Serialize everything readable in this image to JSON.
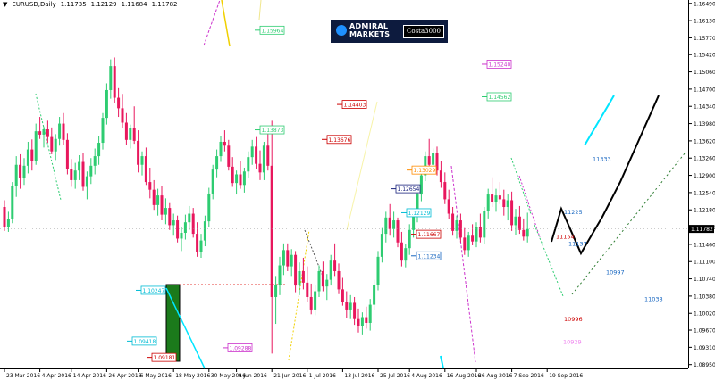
{
  "header": {
    "menu_arrow": "dropdown-triangle",
    "symbol": "EURUSD,Daily",
    "ohlc": [
      "1.11735",
      "1.12129",
      "1.11684",
      "1.11782"
    ]
  },
  "logo": {
    "brand_line1": "ADMIRAL",
    "brand_line2": "MARKETS",
    "username": "Costa3000"
  },
  "colors": {
    "bull": "#2ecc71",
    "bear": "#e8175d",
    "price_tag_bg": "#000000"
  },
  "chart_data": {
    "type": "candlestick",
    "symbol": "EURUSD",
    "timeframe": "Daily",
    "last_price": "1.11782",
    "y_ticks": [
      "1.16490",
      "1.16130",
      "1.15770",
      "1.15420",
      "1.15060",
      "1.14700",
      "1.14340",
      "1.13980",
      "1.13620",
      "1.13260",
      "1.12900",
      "1.12540",
      "1.12180",
      "1.11820",
      "1.11460",
      "1.11100",
      "1.10740",
      "1.10380",
      "1.10020",
      "1.09670",
      "1.09310",
      "1.08950"
    ],
    "ylim": [
      1.0887,
      1.1656
    ],
    "x_ticks": [
      "23 Mar 2016",
      "4 Apr 2016",
      "14 Apr 2016",
      "26 Apr 2016",
      "6 May 2016",
      "18 May 2016",
      "30 May 2016",
      "9 Jun 2016",
      "21 Jun 2016",
      "1 Jul 2016",
      "13 Jul 2016",
      "25 Jul 2016",
      "4 Aug 2016",
      "16 Aug 2016",
      "26 Aug 2016",
      "7 Sep 2016",
      "19 Sep 2016"
    ],
    "x_tick_index": [
      0,
      9,
      17,
      26,
      34,
      43,
      52,
      59,
      68,
      77,
      86,
      95,
      103,
      112,
      120,
      129,
      138
    ],
    "candles": [
      [
        1.1224,
        1.1238,
        1.1174,
        1.1182
      ],
      [
        1.1182,
        1.1214,
        1.1172,
        1.1198
      ],
      [
        1.1198,
        1.1276,
        1.119,
        1.1268
      ],
      [
        1.1268,
        1.133,
        1.1245,
        1.1312
      ],
      [
        1.1312,
        1.1334,
        1.1262,
        1.1284
      ],
      [
        1.1284,
        1.1326,
        1.127,
        1.131
      ],
      [
        1.131,
        1.136,
        1.1294,
        1.1344
      ],
      [
        1.1344,
        1.1365,
        1.13,
        1.132
      ],
      [
        1.132,
        1.1398,
        1.1312,
        1.1382
      ],
      [
        1.1382,
        1.1412,
        1.1366,
        1.1375
      ],
      [
        1.1375,
        1.1392,
        1.1348,
        1.1386
      ],
      [
        1.1386,
        1.1404,
        1.1358,
        1.137
      ],
      [
        1.137,
        1.139,
        1.1334,
        1.134
      ],
      [
        1.134,
        1.1376,
        1.1322,
        1.1366
      ],
      [
        1.1366,
        1.1412,
        1.1352,
        1.1398
      ],
      [
        1.1398,
        1.142,
        1.1354,
        1.1364
      ],
      [
        1.1364,
        1.1378,
        1.1292,
        1.1304
      ],
      [
        1.1304,
        1.1324,
        1.1266,
        1.128
      ],
      [
        1.128,
        1.1316,
        1.1262,
        1.13
      ],
      [
        1.13,
        1.1332,
        1.128,
        1.1318
      ],
      [
        1.1318,
        1.1336,
        1.1258,
        1.1266
      ],
      [
        1.1266,
        1.1298,
        1.124,
        1.1288
      ],
      [
        1.1288,
        1.1326,
        1.1272,
        1.131
      ],
      [
        1.131,
        1.1346,
        1.1292,
        1.133
      ],
      [
        1.133,
        1.1372,
        1.1312,
        1.1358
      ],
      [
        1.1358,
        1.142,
        1.1344,
        1.141
      ],
      [
        1.141,
        1.1482,
        1.1396,
        1.1468
      ],
      [
        1.1468,
        1.1532,
        1.145,
        1.1518
      ],
      [
        1.1518,
        1.1536,
        1.144,
        1.1452
      ],
      [
        1.1452,
        1.1472,
        1.1412,
        1.143
      ],
      [
        1.143,
        1.146,
        1.1388,
        1.14
      ],
      [
        1.14,
        1.142,
        1.1354,
        1.1364
      ],
      [
        1.1364,
        1.1396,
        1.1346,
        1.1388
      ],
      [
        1.1388,
        1.1434,
        1.1356,
        1.1362
      ],
      [
        1.1362,
        1.1384,
        1.1296,
        1.1312
      ],
      [
        1.1312,
        1.134,
        1.129,
        1.133
      ],
      [
        1.133,
        1.1348,
        1.127,
        1.1276
      ],
      [
        1.1276,
        1.1306,
        1.1242,
        1.126
      ],
      [
        1.126,
        1.128,
        1.1218,
        1.1228
      ],
      [
        1.1228,
        1.1262,
        1.1206,
        1.1248
      ],
      [
        1.1248,
        1.1268,
        1.1196,
        1.1208
      ],
      [
        1.1208,
        1.1242,
        1.1188,
        1.1222
      ],
      [
        1.1222,
        1.1232,
        1.1176,
        1.1186
      ],
      [
        1.1186,
        1.121,
        1.1164,
        1.1196
      ],
      [
        1.1196,
        1.1206,
        1.115,
        1.1158
      ],
      [
        1.1158,
        1.1182,
        1.1132,
        1.117
      ],
      [
        1.117,
        1.1208,
        1.1156,
        1.1192
      ],
      [
        1.1192,
        1.1226,
        1.1176,
        1.121
      ],
      [
        1.121,
        1.1222,
        1.116,
        1.1168
      ],
      [
        1.1168,
        1.1192,
        1.112,
        1.113
      ],
      [
        1.113,
        1.1168,
        1.1118,
        1.1154
      ],
      [
        1.1154,
        1.1206,
        1.1142,
        1.1194
      ],
      [
        1.1194,
        1.1264,
        1.1182,
        1.1252
      ],
      [
        1.1252,
        1.1312,
        1.124,
        1.1302
      ],
      [
        1.1302,
        1.1344,
        1.1286,
        1.133
      ],
      [
        1.133,
        1.1372,
        1.1318,
        1.136
      ],
      [
        1.136,
        1.1384,
        1.134,
        1.1352
      ],
      [
        1.1352,
        1.1364,
        1.13,
        1.1308
      ],
      [
        1.1308,
        1.1328,
        1.1266,
        1.1274
      ],
      [
        1.1274,
        1.13,
        1.125,
        1.1292
      ],
      [
        1.1292,
        1.132,
        1.1262,
        1.127
      ],
      [
        1.127,
        1.1306,
        1.1254,
        1.1298
      ],
      [
        1.1298,
        1.134,
        1.1284,
        1.1328
      ],
      [
        1.1328,
        1.1364,
        1.1312,
        1.135
      ],
      [
        1.135,
        1.137,
        1.1304,
        1.1314
      ],
      [
        1.1314,
        1.1342,
        1.128,
        1.1296
      ],
      [
        1.1296,
        1.136,
        1.128,
        1.1352
      ],
      [
        1.1352,
        1.1376,
        1.13,
        1.131
      ],
      [
        1.131,
        1.1404,
        1.0918,
        1.1036
      ],
      [
        1.1036,
        1.108,
        1.098,
        1.1062
      ],
      [
        1.1062,
        1.112,
        1.104,
        1.1102
      ],
      [
        1.1102,
        1.1148,
        1.1082,
        1.1134
      ],
      [
        1.1134,
        1.1148,
        1.109,
        1.11
      ],
      [
        1.11,
        1.1136,
        1.108,
        1.1124
      ],
      [
        1.1124,
        1.1132,
        1.1046,
        1.106
      ],
      [
        1.106,
        1.1108,
        1.104,
        1.109
      ],
      [
        1.109,
        1.1118,
        1.1052,
        1.1066
      ],
      [
        1.1066,
        1.11,
        1.1026,
        1.1036
      ],
      [
        1.1036,
        1.1064,
        1.1,
        1.101
      ],
      [
        1.101,
        1.106,
        1.0998,
        1.1048
      ],
      [
        1.1048,
        1.1102,
        1.1036,
        1.109
      ],
      [
        1.109,
        1.111,
        1.1048,
        1.1058
      ],
      [
        1.1058,
        1.1084,
        1.103,
        1.1072
      ],
      [
        1.1072,
        1.1124,
        1.106,
        1.1112
      ],
      [
        1.1112,
        1.1148,
        1.108,
        1.109
      ],
      [
        1.109,
        1.1106,
        1.1042,
        1.1052
      ],
      [
        1.1052,
        1.1076,
        1.1018,
        1.1026
      ],
      [
        1.1026,
        1.1048,
        1.0992,
        1.101
      ],
      [
        1.101,
        1.104,
        1.099,
        1.1024
      ],
      [
        1.1024,
        1.1036,
        1.0978,
        1.099
      ],
      [
        1.099,
        1.1012,
        1.0962,
        1.0976
      ],
      [
        1.0976,
        1.1004,
        1.0958,
        1.0994
      ],
      [
        1.0994,
        1.1016,
        1.097,
        1.0982
      ],
      [
        1.0982,
        1.1032,
        1.0966,
        1.102
      ],
      [
        1.102,
        1.1072,
        1.1008,
        1.1062
      ],
      [
        1.1062,
        1.1132,
        1.105,
        1.112
      ],
      [
        1.112,
        1.118,
        1.1108,
        1.1168
      ],
      [
        1.1168,
        1.1214,
        1.115,
        1.1202
      ],
      [
        1.1202,
        1.123,
        1.1164,
        1.1178
      ],
      [
        1.1178,
        1.1214,
        1.116,
        1.1196
      ],
      [
        1.1196,
        1.1202,
        1.114,
        1.115
      ],
      [
        1.115,
        1.1172,
        1.11,
        1.1112
      ],
      [
        1.1112,
        1.1146,
        1.1098,
        1.1138
      ],
      [
        1.1138,
        1.1188,
        1.1124,
        1.1176
      ],
      [
        1.1176,
        1.1218,
        1.116,
        1.1204
      ],
      [
        1.1204,
        1.1262,
        1.1192,
        1.125
      ],
      [
        1.125,
        1.1302,
        1.1236,
        1.129
      ],
      [
        1.129,
        1.134,
        1.1278,
        1.133
      ],
      [
        1.133,
        1.1366,
        1.13,
        1.1312
      ],
      [
        1.1312,
        1.1346,
        1.1296,
        1.1336
      ],
      [
        1.1336,
        1.135,
        1.129,
        1.13
      ],
      [
        1.13,
        1.132,
        1.1264,
        1.1276
      ],
      [
        1.1276,
        1.1296,
        1.123,
        1.124
      ],
      [
        1.124,
        1.126,
        1.1198,
        1.121
      ],
      [
        1.121,
        1.1224,
        1.1164,
        1.1174
      ],
      [
        1.1174,
        1.1206,
        1.1158,
        1.1196
      ],
      [
        1.1196,
        1.121,
        1.115,
        1.116
      ],
      [
        1.116,
        1.118,
        1.1124,
        1.1134
      ],
      [
        1.1134,
        1.1172,
        1.112,
        1.1164
      ],
      [
        1.1164,
        1.1188,
        1.1144,
        1.1152
      ],
      [
        1.1152,
        1.1192,
        1.114,
        1.1182
      ],
      [
        1.1182,
        1.121,
        1.115,
        1.116
      ],
      [
        1.116,
        1.1224,
        1.1146,
        1.1216
      ],
      [
        1.1216,
        1.1262,
        1.12,
        1.125
      ],
      [
        1.125,
        1.1286,
        1.1224,
        1.1234
      ],
      [
        1.1234,
        1.1262,
        1.1214,
        1.1248
      ],
      [
        1.1248,
        1.1276,
        1.123,
        1.124
      ],
      [
        1.124,
        1.126,
        1.1206,
        1.1224
      ],
      [
        1.1224,
        1.125,
        1.1196,
        1.1238
      ],
      [
        1.1238,
        1.1256,
        1.1174,
        1.1186
      ],
      [
        1.1186,
        1.122,
        1.1166,
        1.1204
      ],
      [
        1.1204,
        1.1226,
        1.1168,
        1.1176
      ],
      [
        1.1176,
        1.12,
        1.1154,
        1.1162
      ],
      [
        1.1162,
        1.1212,
        1.115,
        1.1178
      ]
    ],
    "levels": [
      {
        "label": "1.15964",
        "price": 1.1593,
        "color": "#2ecc71",
        "box": true
      },
      {
        "label": "1.15240",
        "price": 1.1522,
        "color": "#cc33cc",
        "box": true
      },
      {
        "label": "1.14562",
        "price": 1.1454,
        "color": "#2ecc71",
        "box": true
      },
      {
        "label": "1.14403",
        "price": 1.1438,
        "color": "#cc0000",
        "box": true
      },
      {
        "label": "1.13873",
        "price": 1.1385,
        "color": "#2ecc71",
        "box": true
      },
      {
        "label": "1.13676",
        "price": 1.1365,
        "color": "#cc0000",
        "box": true
      },
      {
        "label": "1.13029",
        "price": 1.1301,
        "color": "#ff8c00",
        "box": true
      },
      {
        "label": "1.12654",
        "price": 1.1262,
        "color": "#1a237e",
        "box": true
      },
      {
        "label": "1.12129",
        "price": 1.1212,
        "color": "#00bcd4",
        "box": true
      },
      {
        "label": "1.11667",
        "price": 1.1167,
        "color": "#cc0000",
        "box": true
      },
      {
        "label": "1.11234",
        "price": 1.1122,
        "color": "#1565c0",
        "box": true
      },
      {
        "label": "1.10247",
        "price": 1.105,
        "color": "#00bcd4",
        "box": true
      },
      {
        "label": "1.09418",
        "price": 1.0944,
        "color": "#00bcd4",
        "box": true
      },
      {
        "label": "1.09288",
        "price": 1.093,
        "color": "#cc33cc",
        "box": true
      },
      {
        "label": "1.09181",
        "price": 1.091,
        "color": "#cc0000",
        "box": true
      }
    ],
    "projection_points": [
      {
        "label": "11225",
        "price": 1.1214,
        "color": "#1565c0"
      },
      {
        "label": "11154",
        "price": 1.1163,
        "color": "#cc0000"
      },
      {
        "label": "11333",
        "price": 1.1325,
        "color": "#1565c0"
      },
      {
        "label": "11137",
        "price": 1.1148,
        "color": "#1565c0"
      },
      {
        "label": "10997",
        "price": 1.1088,
        "color": "#1565c0"
      },
      {
        "label": "11038",
        "price": 1.1032,
        "color": "#1565c0"
      },
      {
        "label": "10996",
        "price": 1.099,
        "color": "#cc0000"
      },
      {
        "label": "10929",
        "price": 1.0943,
        "color": "#ee82ee"
      }
    ]
  }
}
